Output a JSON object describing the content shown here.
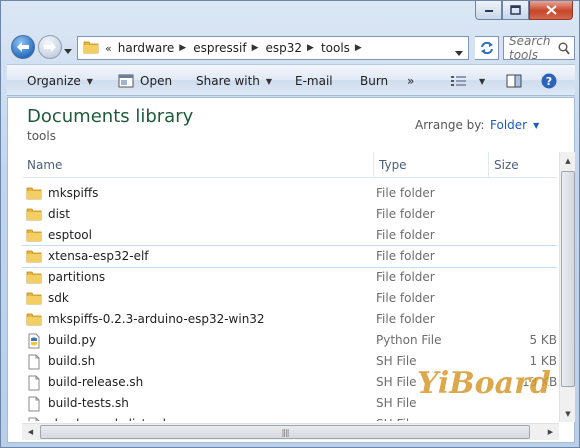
{
  "address": {
    "overflow_chevron": "«",
    "breadcrumbs": [
      "hardware",
      "espressif",
      "esp32",
      "tools"
    ]
  },
  "search": {
    "placeholder": "Search tools"
  },
  "commands": {
    "organize": "Organize",
    "open": "Open",
    "share_with": "Share with",
    "email": "E-mail",
    "burn": "Burn",
    "more": "»"
  },
  "library": {
    "title": "Documents library",
    "subtitle": "tools",
    "arrange_by_label": "Arrange by:",
    "arrange_by_value": "Folder"
  },
  "columns": {
    "name": "Name",
    "type": "Type",
    "size": "Size"
  },
  "files": [
    {
      "name": "mkspiffs",
      "type": "File folder",
      "size": "",
      "icon": "folder-icon"
    },
    {
      "name": "dist",
      "type": "File folder",
      "size": "",
      "icon": "folder-icon"
    },
    {
      "name": "esptool",
      "type": "File folder",
      "size": "",
      "icon": "folder-icon"
    },
    {
      "name": "xtensa-esp32-elf",
      "type": "File folder",
      "size": "",
      "icon": "folder-icon"
    },
    {
      "name": "partitions",
      "type": "File folder",
      "size": "",
      "icon": "folder-icon"
    },
    {
      "name": "sdk",
      "type": "File folder",
      "size": "",
      "icon": "folder-icon"
    },
    {
      "name": "mkspiffs-0.2.3-arduino-esp32-win32",
      "type": "File folder",
      "size": "",
      "icon": "folder-icon"
    },
    {
      "name": "build.py",
      "type": "Python File",
      "size": "5 KB",
      "icon": "python-file-icon"
    },
    {
      "name": "build.sh",
      "type": "SH File",
      "size": "1 KB",
      "icon": "file-icon"
    },
    {
      "name": "build-release.sh",
      "type": "SH File",
      "size": "13 KB",
      "icon": "file-icon"
    },
    {
      "name": "build-tests.sh",
      "type": "SH File",
      "size": "",
      "icon": "file-icon"
    },
    {
      "name": "check_cmakelists.sh",
      "type": "SH File",
      "size": "",
      "icon": "file-icon"
    }
  ],
  "watermark": "YiBoard",
  "colors": {
    "library_title": "#1e5b3a",
    "link": "#1a5ebf",
    "folder": "#e8b73a"
  }
}
